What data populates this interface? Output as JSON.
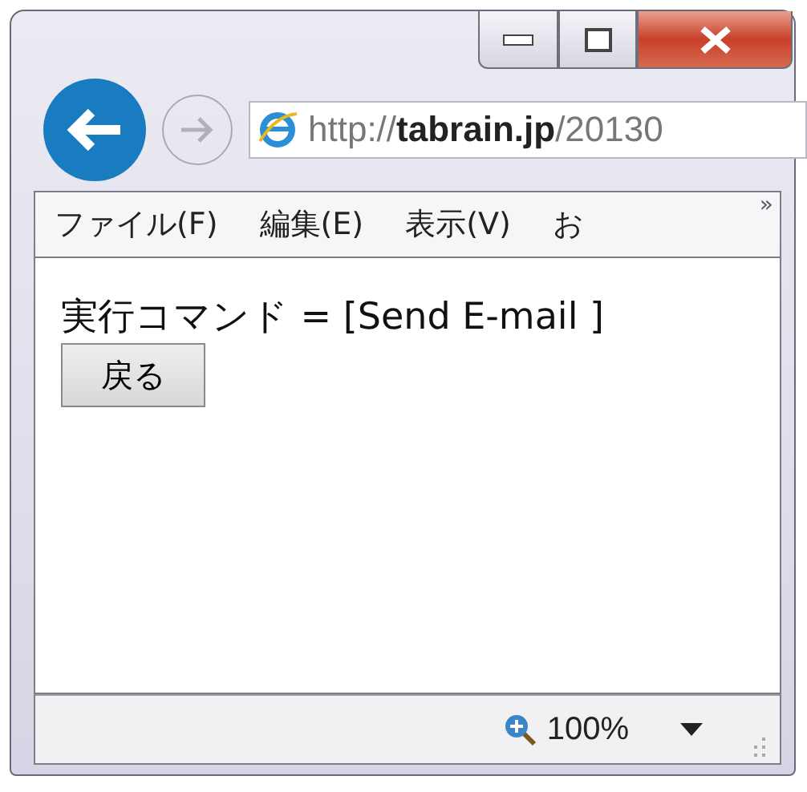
{
  "address_bar": {
    "url": "http://**tabrain.jp**/20130"
  },
  "menu_bar": {
    "items": [
      "ファイル(F)",
      "編集(E)",
      "表示(V)",
      "お"
    ],
    "overflow": "»"
  },
  "page": {
    "text": "実行コマンド = [Send E-mail ]",
    "button": "戻る"
  },
  "status_bar": {
    "zoom": "100%"
  }
}
